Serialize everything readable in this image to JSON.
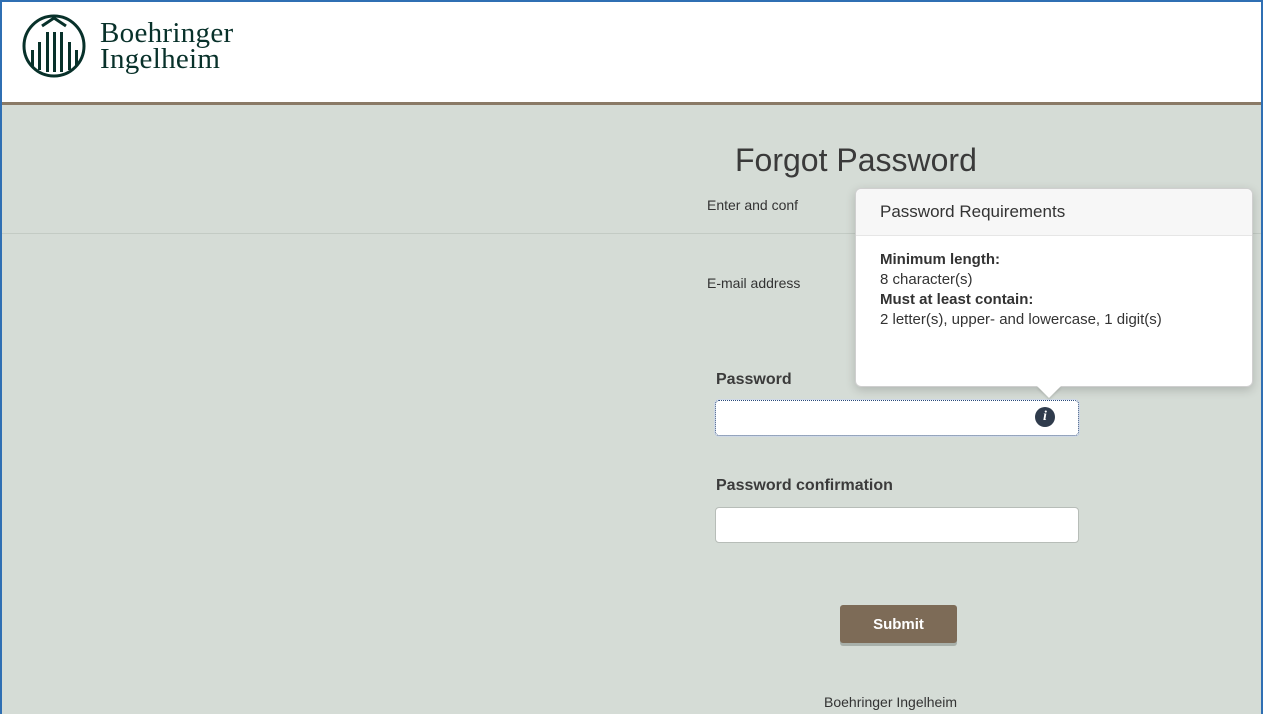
{
  "header": {
    "brand_line1": "Boehringer",
    "brand_line2": "Ingelheim"
  },
  "form": {
    "title": "Forgot Password",
    "subtitle": "Enter and conf",
    "email_label": "E-mail address",
    "password_label": "Password",
    "password_value": "",
    "confirm_label": "Password confirmation",
    "confirm_value": "",
    "submit_label": "Submit"
  },
  "popover": {
    "title": "Password Requirements",
    "min_length_label": "Minimum length:",
    "min_length_value": "8 character(s)",
    "contain_label": "Must at least contain:",
    "contain_value": "2 letter(s), upper- and lowercase, 1 digit(s)"
  },
  "footer": {
    "text": "Boehringer Ingelheim"
  },
  "icons": {
    "info": "info-icon",
    "logo": "boehringer-logo-icon"
  },
  "colors": {
    "accent": "#7d6b57",
    "background": "#d5dcd6",
    "brand": "#08312a"
  }
}
